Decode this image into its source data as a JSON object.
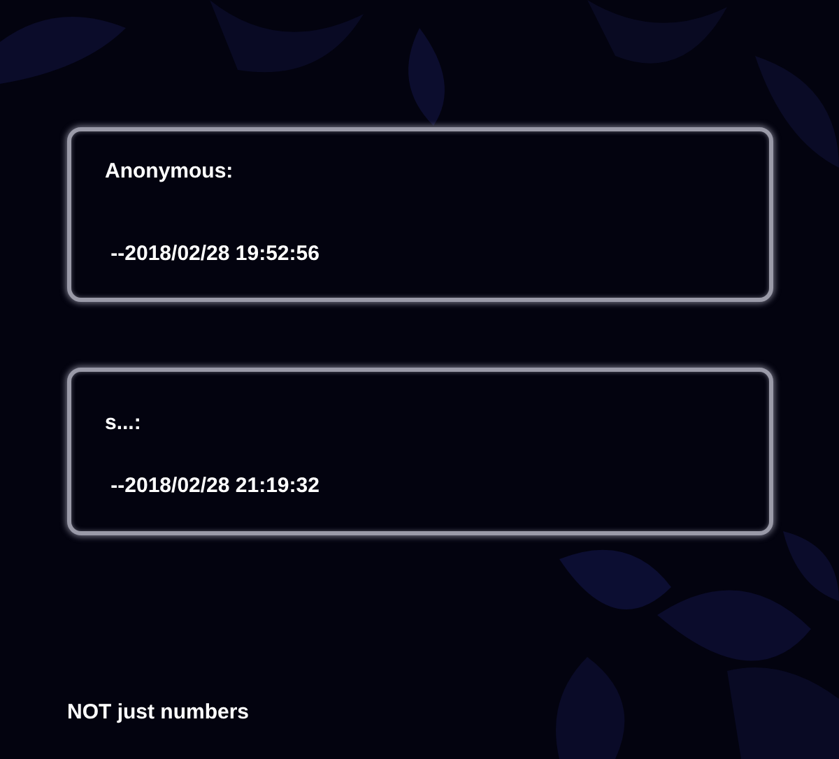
{
  "comments": [
    {
      "author": "Anonymous:",
      "timestamp": " --2018/02/28 19:52:56"
    },
    {
      "author": "s...:",
      "timestamp": " --2018/02/28 21:19:32"
    }
  ],
  "footer": "NOT just numbers"
}
